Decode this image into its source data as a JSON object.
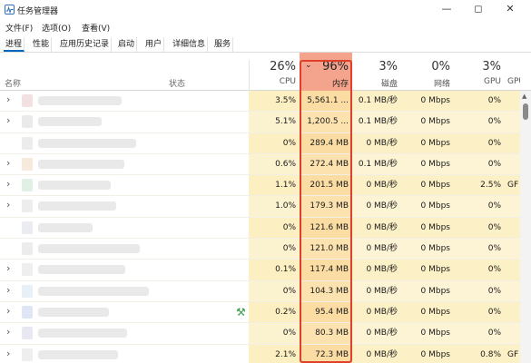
{
  "window": {
    "title": "任务管理器"
  },
  "menu": [
    "文件(F)",
    "选项(O)",
    "查看(V)"
  ],
  "tabs": [
    "进程",
    "性能",
    "应用历史记录",
    "启动",
    "用户",
    "详细信息",
    "服务"
  ],
  "headers": {
    "name": "名称",
    "status": "状态",
    "cpu": {
      "percent": "26%",
      "label": "CPU"
    },
    "memory": {
      "percent": "96%",
      "label": "内存"
    },
    "disk": {
      "percent": "3%",
      "label": "磁盘"
    },
    "network": {
      "percent": "0%",
      "label": "网络"
    },
    "gpu": {
      "percent": "3%",
      "label": "GPU"
    },
    "gpu_engine": {
      "label": "GPU"
    }
  },
  "rows": [
    {
      "cpu": "3.5%",
      "memory": "5,561.1 ...",
      "disk": "0.1 MB/秒",
      "network": "0 Mbps",
      "gpu": "0%",
      "gpu_engine": ""
    },
    {
      "cpu": "5.1%",
      "memory": "1,200.5 ...",
      "disk": "0.1 MB/秒",
      "network": "0 Mbps",
      "gpu": "0%",
      "gpu_engine": ""
    },
    {
      "cpu": "0%",
      "memory": "289.4 MB",
      "disk": "0 MB/秒",
      "network": "0 Mbps",
      "gpu": "0%",
      "gpu_engine": ""
    },
    {
      "cpu": "0.6%",
      "memory": "272.4 MB",
      "disk": "0.1 MB/秒",
      "network": "0 Mbps",
      "gpu": "0%",
      "gpu_engine": ""
    },
    {
      "cpu": "1.1%",
      "memory": "201.5 MB",
      "disk": "0 MB/秒",
      "network": "0 Mbps",
      "gpu": "2.5%",
      "gpu_engine": "GF"
    },
    {
      "cpu": "1.0%",
      "memory": "179.3 MB",
      "disk": "0 MB/秒",
      "network": "0 Mbps",
      "gpu": "0%",
      "gpu_engine": ""
    },
    {
      "cpu": "0%",
      "memory": "121.6 MB",
      "disk": "0 MB/秒",
      "network": "0 Mbps",
      "gpu": "0%",
      "gpu_engine": ""
    },
    {
      "cpu": "0%",
      "memory": "121.0 MB",
      "disk": "0 MB/秒",
      "network": "0 Mbps",
      "gpu": "0%",
      "gpu_engine": ""
    },
    {
      "cpu": "0.1%",
      "memory": "117.4 MB",
      "disk": "0 MB/秒",
      "network": "0 Mbps",
      "gpu": "0%",
      "gpu_engine": ""
    },
    {
      "cpu": "0%",
      "memory": "104.3 MB",
      "disk": "0 MB/秒",
      "network": "0 Mbps",
      "gpu": "0%",
      "gpu_engine": ""
    },
    {
      "cpu": "0.2%",
      "memory": "95.4 MB",
      "disk": "0 MB/秒",
      "network": "0 Mbps",
      "gpu": "0%",
      "gpu_engine": ""
    },
    {
      "cpu": "0%",
      "memory": "80.3 MB",
      "disk": "0 MB/秒",
      "network": "0 Mbps",
      "gpu": "0%",
      "gpu_engine": ""
    },
    {
      "cpu": "2.1%",
      "memory": "72.3 MB",
      "disk": "0 MB/秒",
      "network": "0 Mbps",
      "gpu": "0.8%",
      "gpu_engine": "GF"
    }
  ],
  "colors": {
    "memory_header": "#f4a38c",
    "highlight_border": "#e0402a",
    "accent": "#0067c0"
  }
}
